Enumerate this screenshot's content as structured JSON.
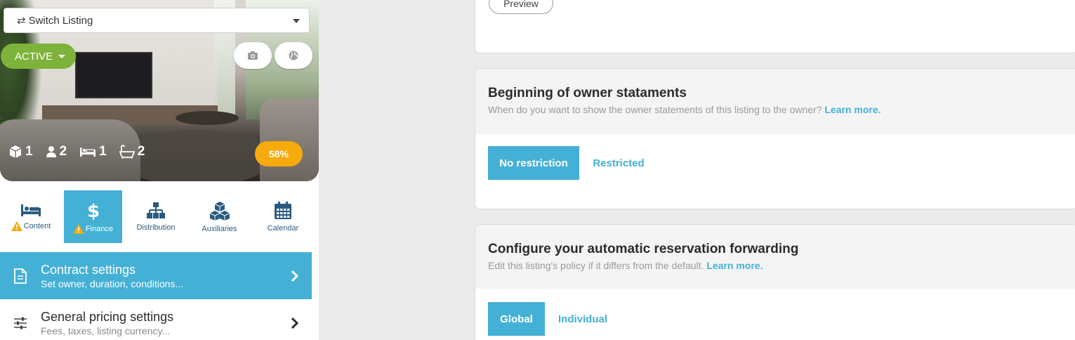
{
  "sidebar": {
    "switch_listing": {
      "label": "Switch Listing"
    },
    "status": {
      "label": "ACTIVE"
    },
    "stats": {
      "units": "1",
      "guests": "2",
      "bedrooms": "1",
      "bathrooms": "2"
    },
    "completion": "58%",
    "tabs": [
      {
        "label": "Content",
        "warning": true
      },
      {
        "label": "Finance",
        "warning": true,
        "selected": true
      },
      {
        "label": "Distribution",
        "warning": false
      },
      {
        "label": "Auxiliaries",
        "warning": false
      },
      {
        "label": "Calendar",
        "warning": false
      }
    ],
    "menu": [
      {
        "title": "Contract settings",
        "subtitle": "Set owner, duration, conditions...",
        "selected": true
      },
      {
        "title": "General pricing settings",
        "subtitle": "Fees, taxes, listing currency...",
        "selected": false
      }
    ]
  },
  "main": {
    "preview_label": "Preview",
    "owner_statements": {
      "title": "Beginning of owner stataments",
      "subtitle": "When do you want to show the owner statements of this listing to the owner?",
      "learn_more": "Learn more.",
      "options": [
        "No restriction",
        "Restricted"
      ]
    },
    "reservation_forwarding": {
      "title": "Configure your automatic reservation forwarding",
      "subtitle": "Edit this listing's policy if it differs from the default.",
      "learn_more": "Learn more.",
      "options": [
        "Global",
        "Individual"
      ]
    }
  },
  "colors": {
    "accent": "#44b0d6",
    "active": "#7db33a",
    "progress": "#f5ab0b",
    "nav_icon": "#2a5a80"
  }
}
